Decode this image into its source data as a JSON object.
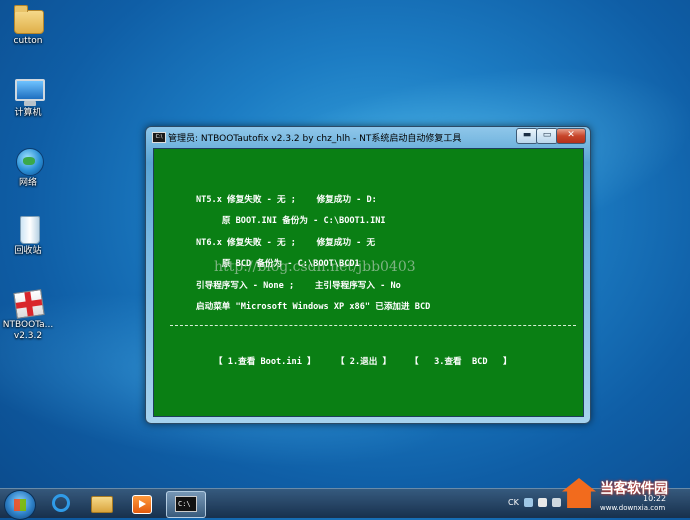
{
  "desktop": {
    "icons": [
      {
        "label": "cutton",
        "icon": "folder-icon"
      },
      {
        "label": "计算机",
        "icon": "computer-icon"
      },
      {
        "label": "网络",
        "icon": "network-icon"
      },
      {
        "label": "回收站",
        "icon": "recycle-bin-icon"
      },
      {
        "label": "NTBOOTa...",
        "label2": "v2.3.2",
        "icon": "ntbootautofix-icon"
      }
    ]
  },
  "window": {
    "title": "管理员: NTBOOTautofix v2.3.2 by chz_hlh - NT系统启动自动修复工具",
    "controls": {
      "minimize": "▬",
      "maximize": "▭",
      "close": "✕"
    },
    "console": {
      "lines": [
        "NT5.x 修复失败 - 无 ;    修复成功 - D:",
        "     原 BOOT.INI 备份为 - C:\\BOOT1.INI",
        "NT6.x 修复失败 - 无 ;    修复成功 - 无",
        "     原 BCD 备份为 - C:\\BOOT\\BCD1",
        "引导程序写入 - None ;    主引导程序写入 - No",
        "启动菜单 \"Microsoft Windows XP x86\" 已添加进 BCD"
      ],
      "watermark": "http://blog.csdn.net/jbb0403",
      "menu": [
        "【 1.查看 Boot.ini 】",
        "【 2.退出 】",
        "【   3.查看  BCD   】"
      ]
    }
  },
  "taskbar": {
    "tray_lang": "CK",
    "clock": "10:22",
    "logo_text": "当客软件园",
    "logo_url": "www.downxia.com"
  },
  "colors": {
    "console_bg": "#0a7f14",
    "console_text": "#ffffff",
    "desktop_bg": "#1c7cc3"
  }
}
